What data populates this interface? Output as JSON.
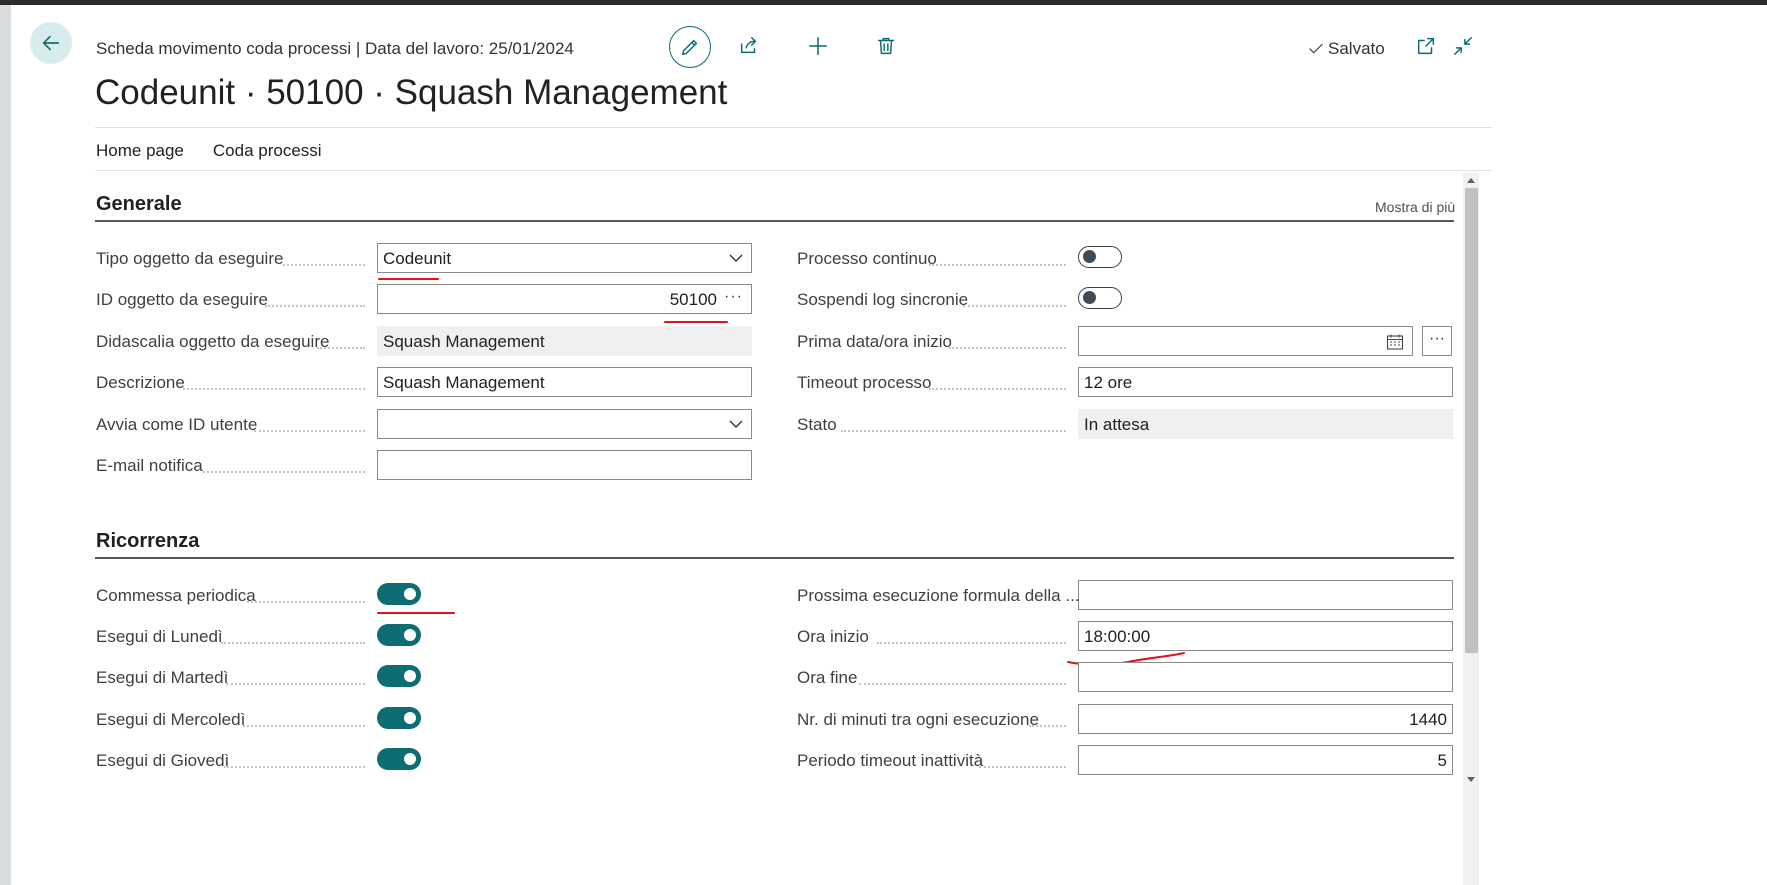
{
  "header": {
    "breadcrumb": "Scheda movimento coda processi | Data del lavoro: 25/01/2024",
    "title": "Codeunit · 50100 · Squash Management",
    "saved_label": "Salvato"
  },
  "actions": [
    "Home page",
    "Coda processi"
  ],
  "generale": {
    "title": "Generale",
    "more_link": "Mostra di più",
    "left": [
      {
        "label": "Tipo oggetto da eseguire",
        "value": "Codeunit"
      },
      {
        "label": "ID oggetto da eseguire",
        "value": "50100"
      },
      {
        "label": "Didascalia oggetto da eseguire",
        "value": "Squash Management"
      },
      {
        "label": "Descrizione",
        "value": "Squash Management"
      },
      {
        "label": "Avvia come ID utente",
        "value": ""
      },
      {
        "label": "E-mail notifica",
        "value": ""
      }
    ],
    "right": [
      {
        "label": "Processo continuo",
        "toggle": false
      },
      {
        "label": "Sospendi log sincronie",
        "toggle": false
      },
      {
        "label": "Prima data/ora inizio",
        "value": ""
      },
      {
        "label": "Timeout processo",
        "value": "12 ore"
      },
      {
        "label": "Stato",
        "value": "In attesa"
      }
    ]
  },
  "ricorrenza": {
    "title": "Ricorrenza",
    "left": [
      {
        "label": "Commessa periodica",
        "toggle": true
      },
      {
        "label": "Esegui di Lunedì",
        "toggle": true
      },
      {
        "label": "Esegui di Martedì",
        "toggle": true
      },
      {
        "label": "Esegui di Mercoledì",
        "toggle": true
      },
      {
        "label": "Esegui di Giovedì",
        "toggle": true
      }
    ],
    "right": [
      {
        "label": "Prossima esecuzione formula della ...",
        "value": ""
      },
      {
        "label": "Ora inizio",
        "value": "18:00:00"
      },
      {
        "label": "Ora fine",
        "value": ""
      },
      {
        "label": "Nr. di minuti tra ogni esecuzione",
        "value": "1440"
      },
      {
        "label": "Periodo timeout inattività",
        "value": "5"
      }
    ]
  },
  "colors": {
    "accent": "#0e6c73",
    "annotation": "#e0141e"
  }
}
